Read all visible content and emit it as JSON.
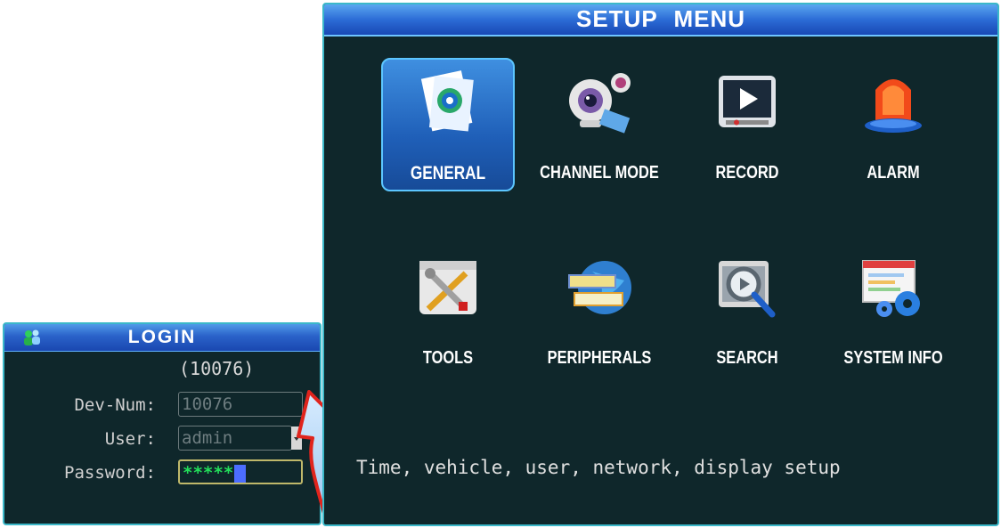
{
  "login": {
    "title": "LOGIN",
    "device_code": "(10076)",
    "fields": {
      "dev_num": {
        "label": "Dev-Num:",
        "value": "10076"
      },
      "user": {
        "label": "User:",
        "value": "admin"
      },
      "password": {
        "label": "Password:",
        "value": "*****"
      }
    }
  },
  "setup_menu": {
    "title": "SETUP MENU",
    "items": [
      {
        "label": "GENERAL",
        "icon": "general-settings-icon",
        "selected": true
      },
      {
        "label": "CHANNEL MODE",
        "icon": "webcam-icon",
        "selected": false
      },
      {
        "label": "RECORD",
        "icon": "record-play-icon",
        "selected": false
      },
      {
        "label": "ALARM",
        "icon": "alarm-siren-icon",
        "selected": false
      },
      {
        "label": "TOOLS",
        "icon": "tools-icon",
        "selected": false
      },
      {
        "label": "PERIPHERALS",
        "icon": "globe-peripherals-icon",
        "selected": false
      },
      {
        "label": "SEARCH",
        "icon": "search-magnifier-icon",
        "selected": false
      },
      {
        "label": "SYSTEM INFO",
        "icon": "system-info-gear-icon",
        "selected": false
      }
    ],
    "description": "Time, vehicle, user, network, display setup"
  },
  "colors": {
    "panel_bg": "#0f272b",
    "panel_border": "#3bb8c9",
    "title_bar": "#2a62c9",
    "arrow": "#e0241d"
  }
}
